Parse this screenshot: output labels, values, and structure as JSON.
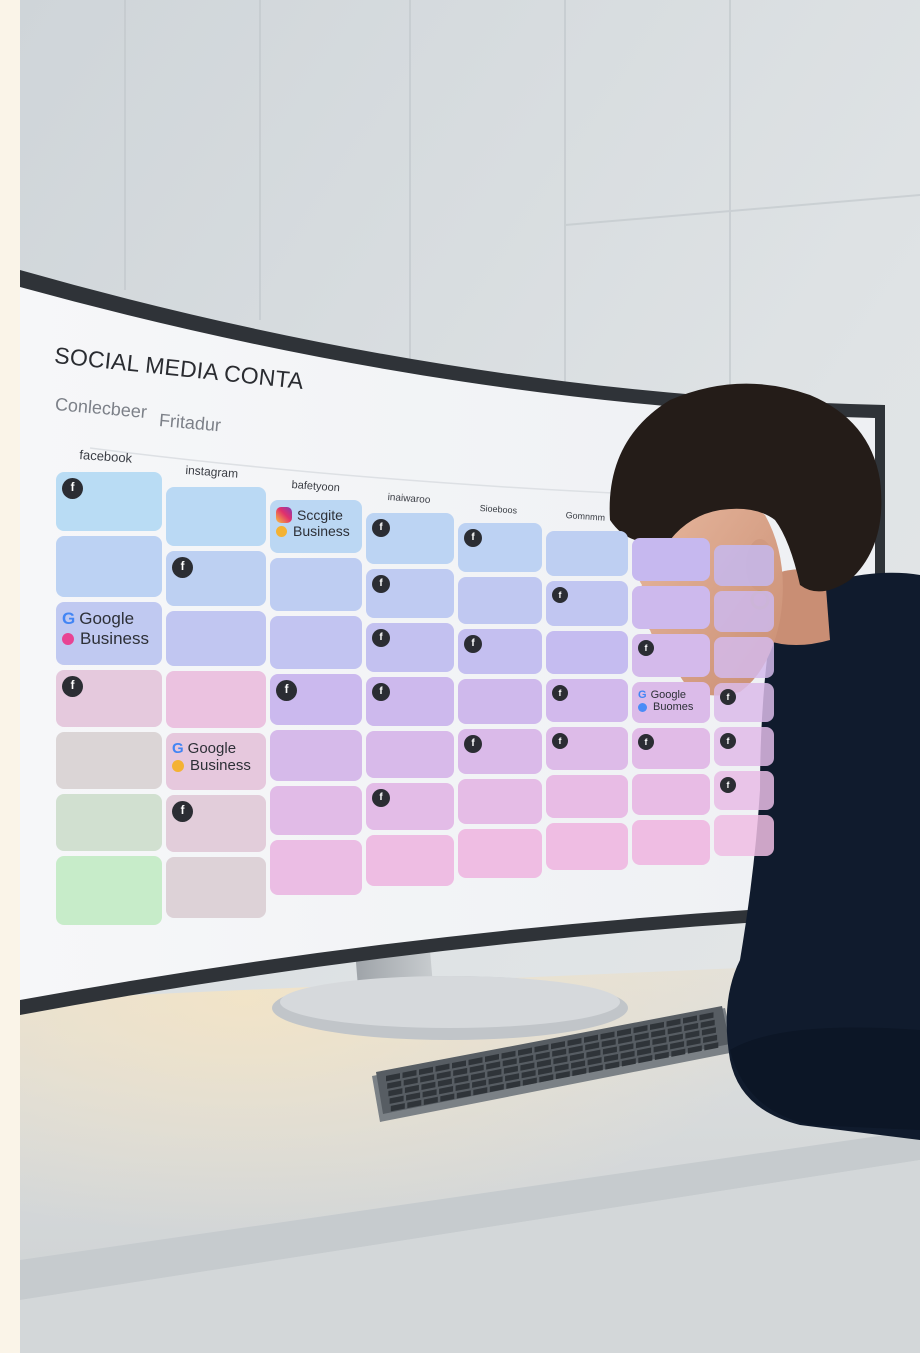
{
  "screen": {
    "title": "SOCIAL MEDIA CONTA",
    "tabs": [
      "Conlecbeer",
      "Fritadur"
    ]
  },
  "calendar": {
    "column_headers": [
      "facebook",
      "instagram",
      "bafetyoon",
      "inaiwaroo",
      "Sioeboos",
      "Gomnmm"
    ],
    "badges": [
      {
        "line1": "Google",
        "line2": "Business",
        "dot_color": "#e84393",
        "logo": "G"
      },
      {
        "line1": "Google",
        "line2": "Business",
        "dot_color": "#f4b233",
        "logo": "G"
      },
      {
        "line1": "Sccgite",
        "line2": "Business",
        "dot_color": "#f4b233",
        "logo": "ig"
      },
      {
        "line1": "Google",
        "line2": "Buomes",
        "dot_color": "#4a8cf7",
        "logo": "G"
      }
    ],
    "icon_glyph": "f"
  },
  "colors": {
    "screen_bg": "#f4f5f7",
    "cell_blue": "#b9dcf4",
    "cell_purple": "#c6b8ef",
    "cell_pink": "#efbde3",
    "cell_green": "#c7ecc9",
    "icon_bg": "#2b2d33",
    "sweater": "#0f1a2c",
    "wall": "#d9dde0",
    "desk": "#dcdfe0"
  }
}
